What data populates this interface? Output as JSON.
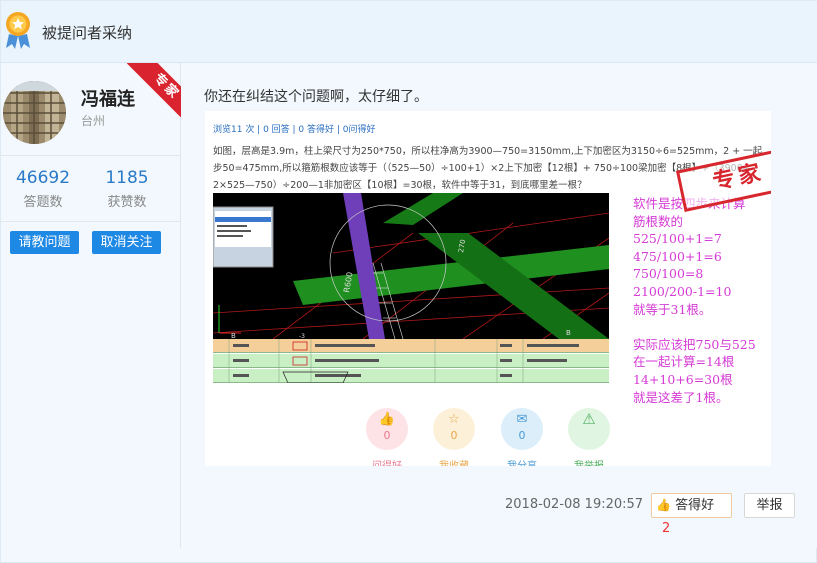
{
  "header": {
    "title": "被提问者采纳"
  },
  "user": {
    "name": "冯福连",
    "location": "台州",
    "badge": "专家"
  },
  "stats": [
    {
      "value": "46692",
      "label": "答题数"
    },
    {
      "value": "1185",
      "label": "获赞数"
    }
  ],
  "buttons": {
    "ask": "请教问题",
    "unfollow": "取消关注"
  },
  "answer": {
    "text": "你还在纠结这个问题啊，太仔细了。"
  },
  "embedded": {
    "meta": "浏览11 次 | 0 回答 | 0 答得好 | 0问得好",
    "question": "如图，层高是3.9m，柱上梁尺寸为250*750，所以柱净高为3900—750=3150mm,上下加密区为3150÷6=525mm，2 + 一起步50=475mm,所以箍筋根数应该等于（（525—50）÷100+1）×2上下加密【12根】+ 750÷100梁加密【8根】+（3900—2×525—750）÷200—1非加密区【10根】=30根，软件中等于31，到底哪里差一根？",
    "stamp": "专家",
    "annotation": [
      "软件是按四步来计算",
      "筋根数的",
      "525/100+1=7",
      "475/100+1=6",
      "750/100=8",
      "2100/200-1=10",
      "就等于31根。",
      "",
      "实际应该把750与525",
      "在一起计算=14根",
      "14+10+6=30根",
      "就是这差了1根。"
    ],
    "actions": [
      {
        "count": "0",
        "label": "问得好",
        "color": "#fde3e6"
      },
      {
        "count": "0",
        "label": "我收藏",
        "color": "#fdf0d8"
      },
      {
        "count": "0",
        "label": "我分享",
        "color": "#dbeefa"
      },
      {
        "count": "0",
        "label": "我举报",
        "color": "#e0f5e2"
      }
    ]
  },
  "footer": {
    "timestamp": "2018-02-08 19:20:57",
    "good_label": "答得好",
    "good_count": "2",
    "report_label": "举报"
  }
}
